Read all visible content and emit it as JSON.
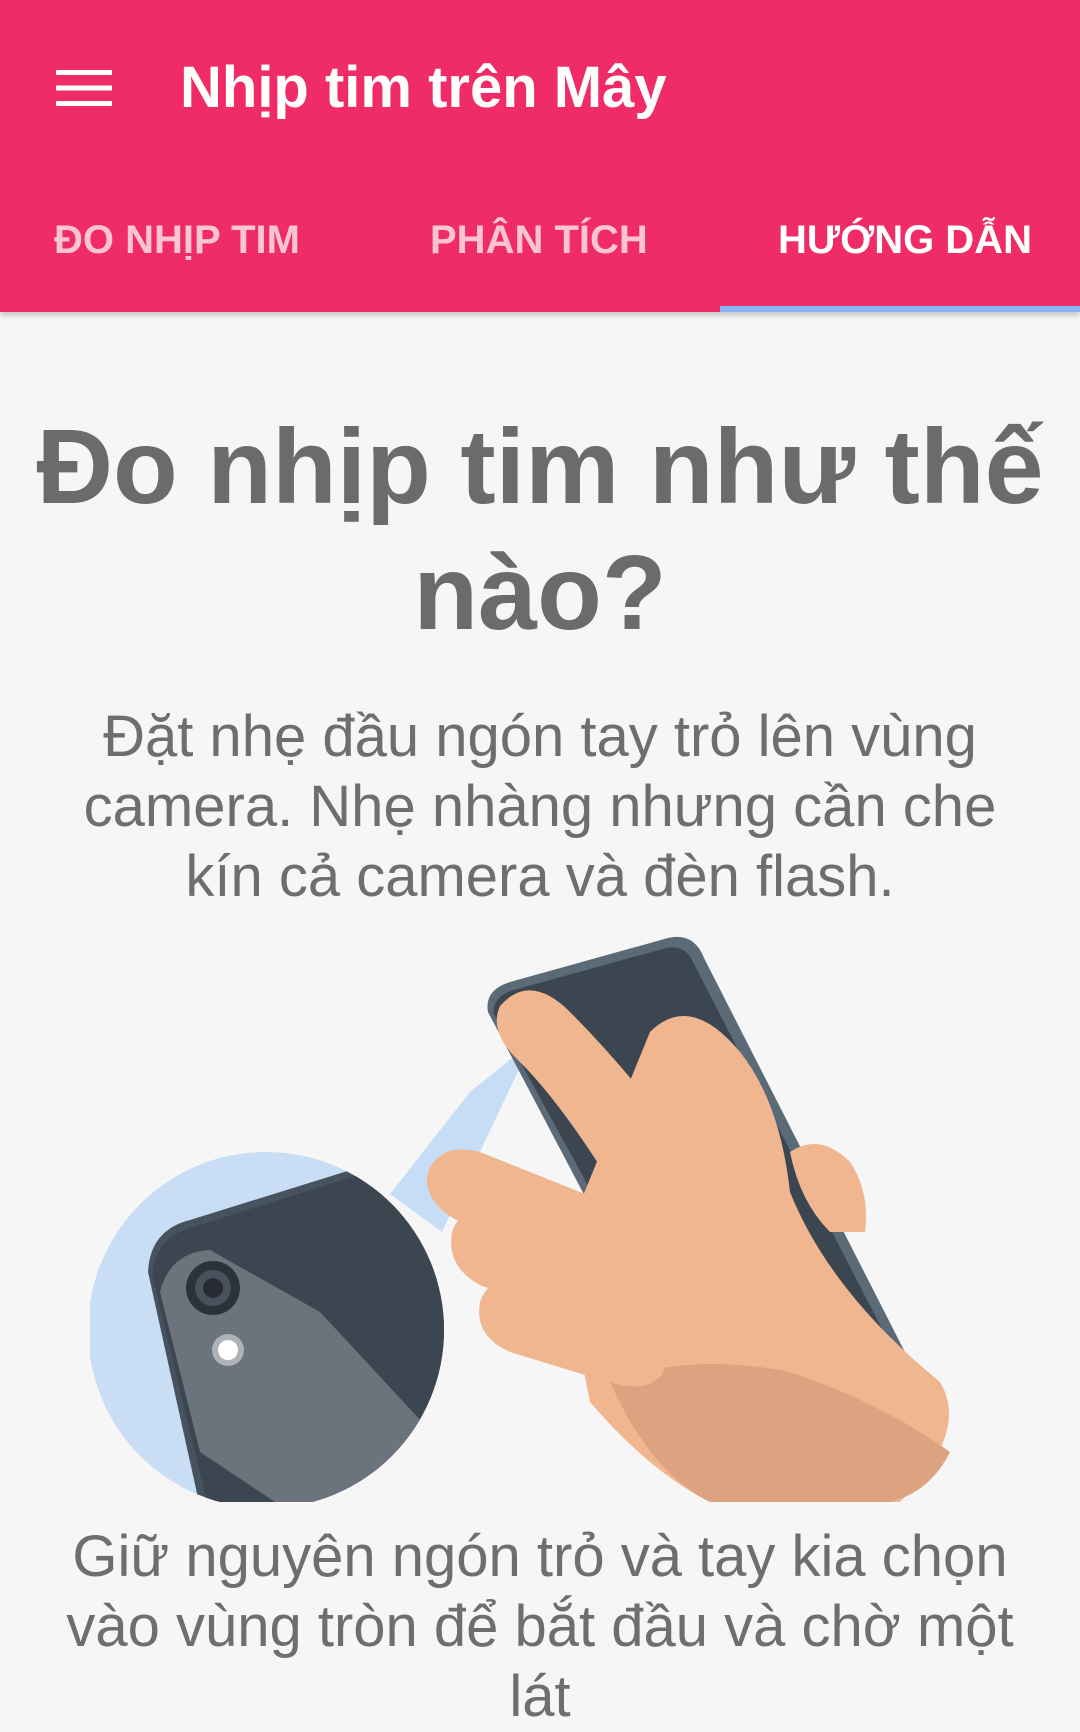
{
  "appbar": {
    "title": "Nhịp tim trên Mây",
    "menu_icon": "hamburger-menu-icon",
    "color": "#ef2c67"
  },
  "tabs": [
    {
      "label": "ĐO NHỊP TIM",
      "active": false
    },
    {
      "label": "PHÂN TÍCH",
      "active": false
    },
    {
      "label": "HƯỚNG DẪN",
      "active": true
    }
  ],
  "tab_indicator_color": "#8ab4f8",
  "guide": {
    "heading": "Đo nhịp tim như thế nào?",
    "step1": "Đặt nhẹ đầu ngón tay trỏ lên vùng camera. Nhẹ nhàng nhưng cần che kín cả camera và đèn flash.",
    "step2": "Giữ nguyên ngón trỏ và tay kia chọn vào vùng tròn để bắt đầu và chờ một lát"
  }
}
